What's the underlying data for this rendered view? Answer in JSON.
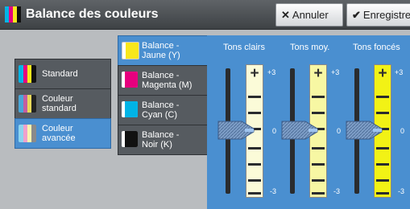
{
  "header": {
    "title": "Balance des couleurs",
    "cancel_label": "Annuler",
    "save_label": "Enregistrer"
  },
  "modes": [
    {
      "label_line1": "Standard",
      "label_line2": "",
      "selected": false
    },
    {
      "label_line1": "Couleur",
      "label_line2": "standard",
      "selected": false
    },
    {
      "label_line1": "Couleur",
      "label_line2": "avancée",
      "selected": true
    }
  ],
  "channels": [
    {
      "label_line1": "Balance -",
      "label_line2": "Jaune (Y)",
      "selected": true
    },
    {
      "label_line1": "Balance -",
      "label_line2": "Magenta (M)",
      "selected": false
    },
    {
      "label_line1": "Balance -",
      "label_line2": "Cyan (C)",
      "selected": false
    },
    {
      "label_line1": "Balance -",
      "label_line2": "Noir (K)",
      "selected": false
    }
  ],
  "sliders": [
    {
      "label": "Tons clairs",
      "max_label": "+3",
      "mid_label": "0",
      "min_label": "-3",
      "value": 0,
      "strip_color": "#fbfbd8"
    },
    {
      "label": "Tons moy.",
      "max_label": "+3",
      "mid_label": "0",
      "min_label": "-3",
      "value": 0,
      "strip_color": "#f7f7a3"
    },
    {
      "label": "Tons foncés",
      "max_label": "+3",
      "mid_label": "0",
      "min_label": "-3",
      "value": 0,
      "strip_color": "#f2f215"
    }
  ],
  "colors": {
    "accent": "#4a8fd0",
    "yellow": "#f8e71c",
    "magenta": "#e6007e",
    "cyan": "#00b4e6",
    "black": "#111111"
  }
}
